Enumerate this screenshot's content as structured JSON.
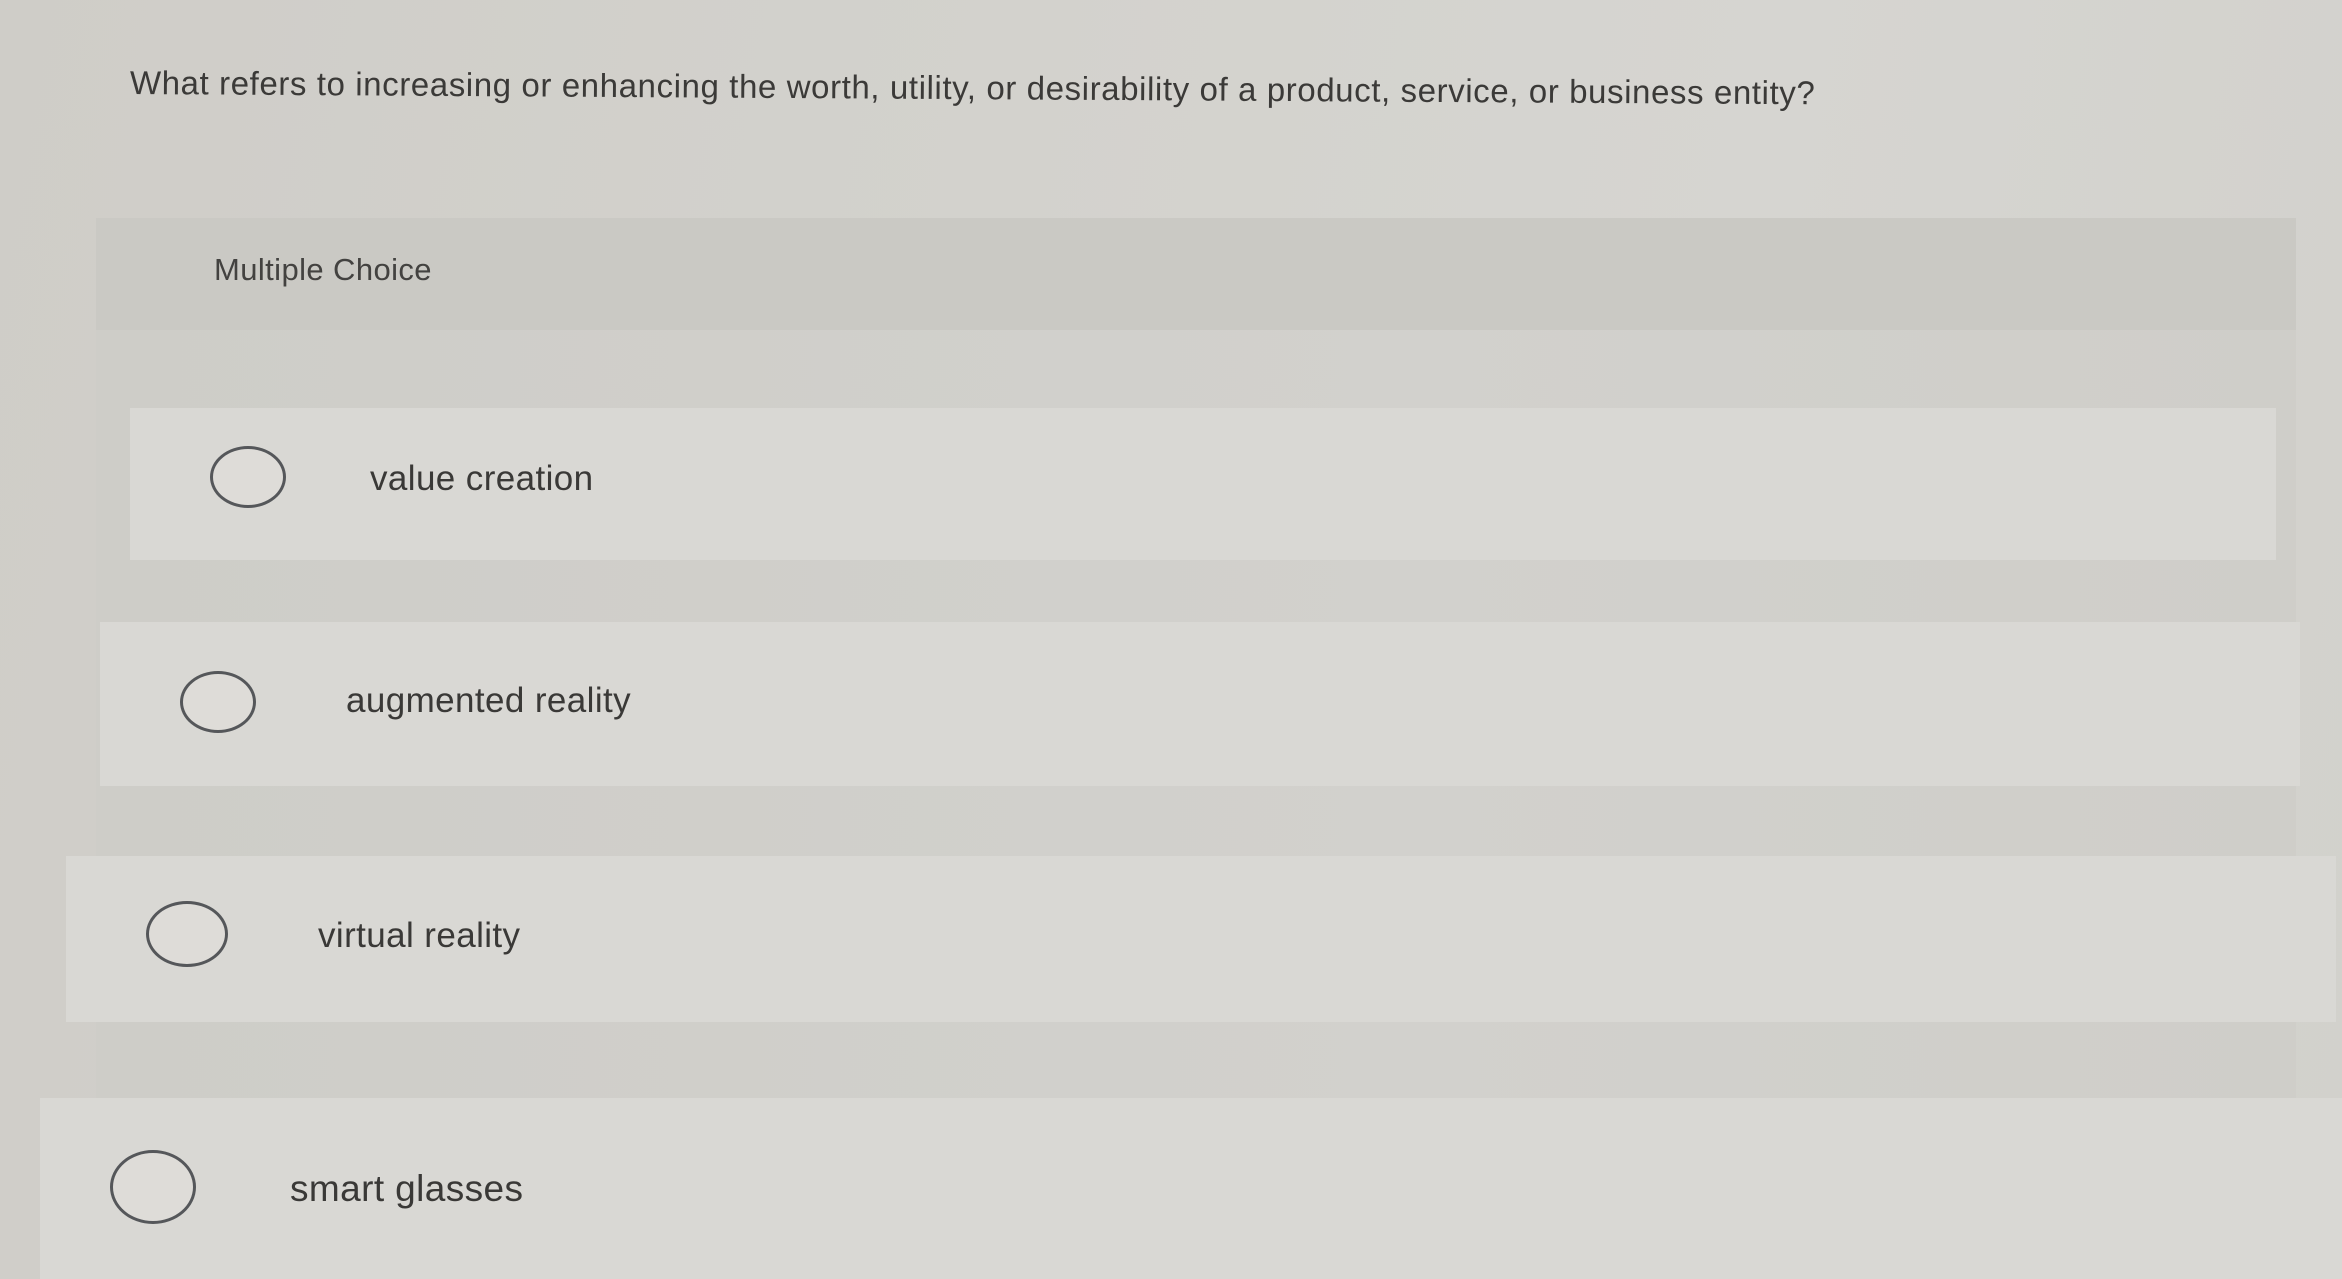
{
  "question": {
    "text": "What refers to increasing or enhancing the worth, utility, or desirability of a product, service, or business entity?"
  },
  "multiple_choice": {
    "label": "Multiple Choice",
    "options": [
      {
        "label": "value creation"
      },
      {
        "label": "augmented reality"
      },
      {
        "label": "virtual reality"
      },
      {
        "label": "smart glasses"
      }
    ]
  }
}
